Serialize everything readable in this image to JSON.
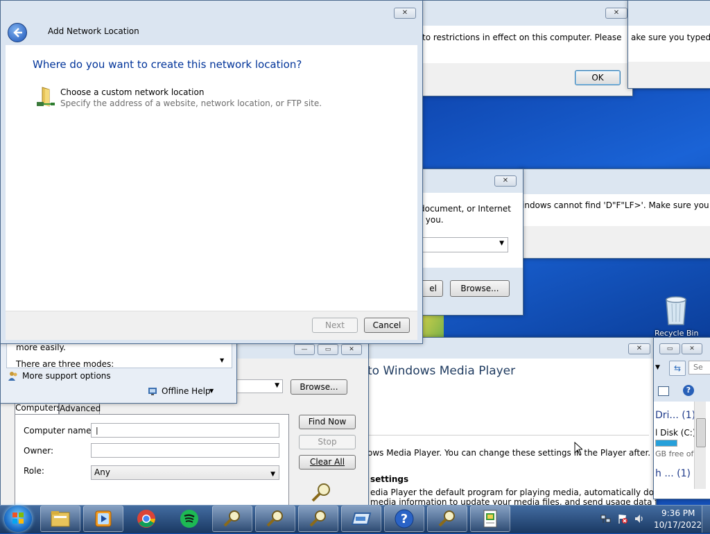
{
  "desktop": {
    "recycle_bin_label": "Recycle Bin"
  },
  "add_network": {
    "title": "Add Network Location",
    "heading": "Where do you want to create this network location?",
    "option_title": "Choose a custom network location",
    "option_desc": "Specify the address of a website, network location, or FTP site.",
    "next_label": "Next",
    "cancel_label": "Cancel"
  },
  "restriction_dialog": {
    "message": "to restrictions in effect on this computer. Please",
    "ok_label": "OK"
  },
  "error_dialog_right": {
    "message1": "ake sure you typed the",
    "message2": "indows cannot find 'D\"F\"LF>'. Make sure you typed"
  },
  "run_dialog": {
    "line1": "document, or Internet",
    "line2": "r you.",
    "cancel_partial": "el",
    "browse_label": "Browse..."
  },
  "help_window": {
    "text1": "more easily.",
    "text2": "There are three modes:",
    "support_label": "More support options",
    "offline_label": "Offline Help"
  },
  "find_window": {
    "browse_label": "Browse...",
    "tab_computers": "Computers",
    "tab_advanced": "Advanced",
    "computer_name_label": "Computer name:",
    "computer_name_value": "|",
    "owner_label": "Owner:",
    "role_label": "Role:",
    "role_value": "Any",
    "find_now": "Find Now",
    "stop": "Stop",
    "clear_all": "Clear All"
  },
  "wmp_window": {
    "heading": "to Windows Media Player",
    "desc": "ows Media Player. You can change these settings in the Player after.",
    "settings_heading": "settings",
    "settings_line1": "edia Player the default program for playing media, automatically download",
    "settings_line2": "media information to update your media files, and send usage data from the"
  },
  "explorer_window": {
    "search_placeholder": "Se",
    "item1": "Dri... (1)",
    "item2": "l Disk (C:)",
    "item3": "GB free of",
    "item4": "h ... (1)"
  },
  "taskbar": {
    "time": "9:36 PM",
    "date": "10/17/2022"
  },
  "colors": {
    "heading_blue": "#003399",
    "taskbar": "#1c3c66"
  }
}
